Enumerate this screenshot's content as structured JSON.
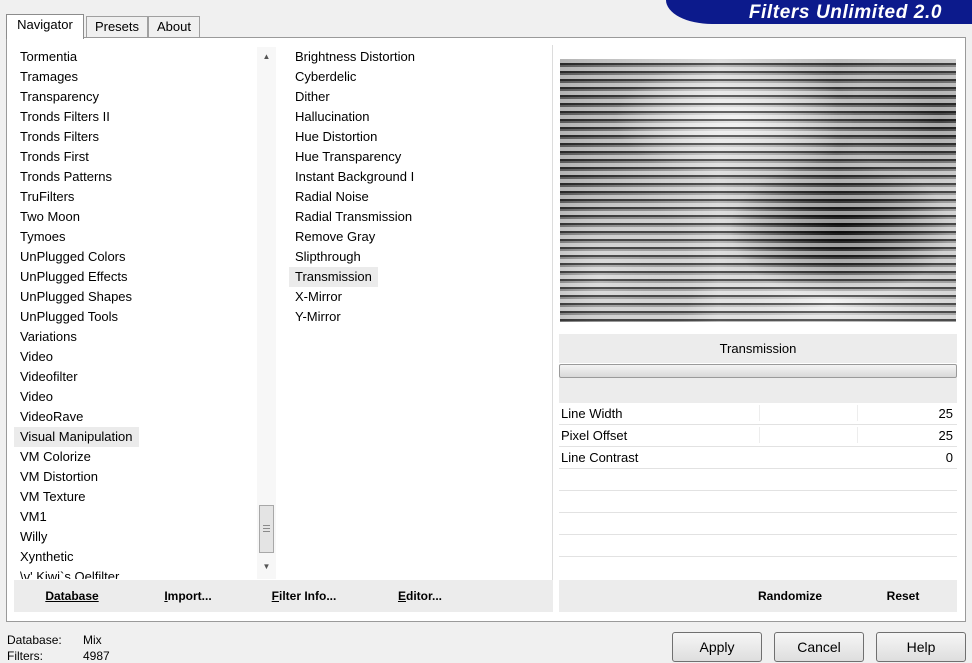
{
  "tabs": [
    {
      "label": "Navigator",
      "active": true
    },
    {
      "label": "Presets",
      "active": false
    },
    {
      "label": "About",
      "active": false
    }
  ],
  "brand": "Filters Unlimited 2.0",
  "categories": [
    "Tormentia",
    "Tramages",
    "Transparency",
    "Tronds Filters II",
    "Tronds Filters",
    "Tronds First",
    "Tronds Patterns",
    "TruFilters",
    "Two Moon",
    "Tymoes",
    "UnPlugged Colors",
    "UnPlugged Effects",
    "UnPlugged Shapes",
    "UnPlugged Tools",
    "Variations",
    "Video",
    "Videofilter",
    "Video",
    "VideoRave",
    "Visual Manipulation",
    "VM Colorize",
    "VM Distortion",
    "VM Texture",
    "VM1",
    "Willy",
    "Xynthetic",
    "\\v' Kiwi`s Oelfilter"
  ],
  "selected_category": "Visual Manipulation",
  "filters": [
    "Brightness Distortion",
    "Cyberdelic",
    "Dither",
    "Hallucination",
    "Hue Distortion",
    "Hue Transparency",
    "Instant Background I",
    "Radial Noise",
    "Radial Transmission",
    "Remove Gray",
    "Slipthrough",
    "Transmission",
    "X-Mirror",
    "Y-Mirror"
  ],
  "selected_filter": "Transmission",
  "filter_title": "Transmission",
  "progress_fraction": 0.0,
  "params": [
    {
      "name": "Line Width",
      "value": "25"
    },
    {
      "name": "Pixel Offset",
      "value": "25"
    },
    {
      "name": "Line Contrast",
      "value": "0"
    }
  ],
  "toolbar_left": [
    {
      "u": "D",
      "rest": "atabase"
    },
    {
      "u": "I",
      "rest": "mport..."
    },
    {
      "u": "F",
      "rest": "ilter Info..."
    },
    {
      "u": "E",
      "rest": "ditor..."
    }
  ],
  "toolbar_right": {
    "randomize": "Randomize",
    "reset": "Reset"
  },
  "status": {
    "database_label": "Database:",
    "database_value": "Mix",
    "filters_label": "Filters:",
    "filters_value": "4987"
  },
  "buttons": {
    "apply": "Apply",
    "cancel": "Cancel",
    "help": "Help"
  },
  "icons": {
    "scroll_up": "triangle-up",
    "scroll_down": "triangle-down"
  }
}
